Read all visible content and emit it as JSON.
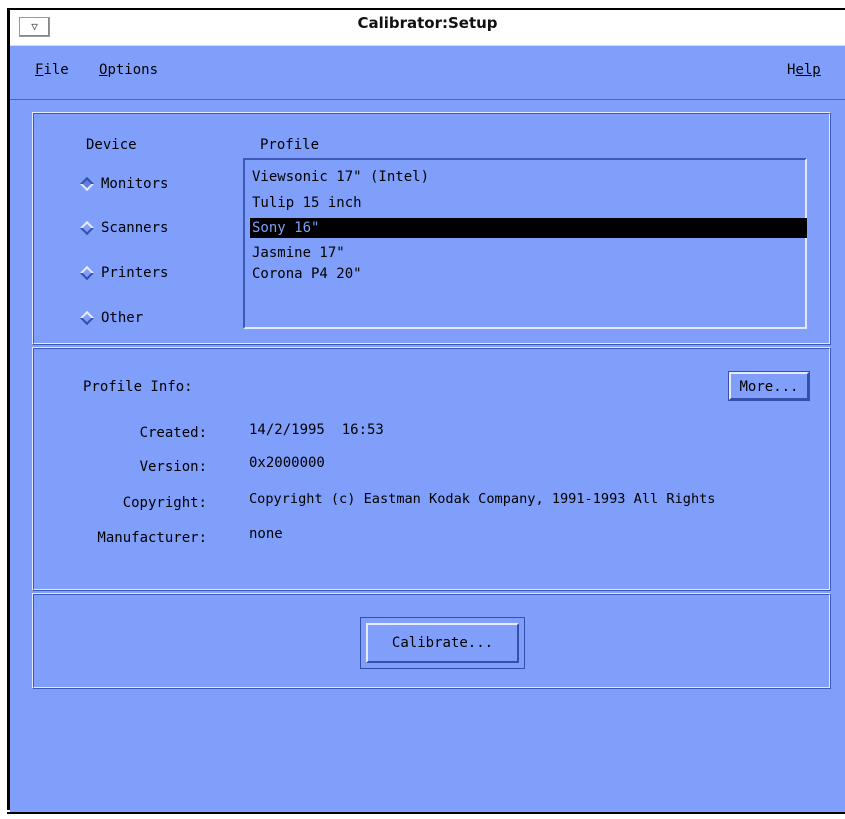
{
  "window": {
    "title": "Calibrator:Setup",
    "menu_button_glyph": "▽"
  },
  "menubar": {
    "file": {
      "mnemonic": "F",
      "rest": "ile"
    },
    "options": {
      "mnemonic": "O",
      "rest": "ptions"
    },
    "help": {
      "lead": "H",
      "rest": "elp"
    }
  },
  "device": {
    "heading": "Device",
    "options": [
      {
        "label": "Monitors",
        "selected": true
      },
      {
        "label": "Scanners",
        "selected": false
      },
      {
        "label": "Printers",
        "selected": false
      },
      {
        "label": "Other",
        "selected": false
      }
    ]
  },
  "profile": {
    "heading": "Profile",
    "items": [
      {
        "label": "Viewsonic 17\" (Intel)",
        "selected": false
      },
      {
        "label": "Tulip 15 inch",
        "selected": false
      },
      {
        "label": "Sony 16\"",
        "selected": true
      },
      {
        "label": "Jasmine 17\"",
        "selected": false
      },
      {
        "label": "Corona P4 20\"",
        "selected": false
      }
    ]
  },
  "profile_info": {
    "heading": "Profile Info:",
    "more_button": "More...",
    "created_label": "Created:",
    "created_value": "14/2/1995  16:53",
    "version_label": "Version:",
    "version_value": "0x2000000",
    "copyright_label": "Copyright:",
    "copyright_value": "Copyright (c) Eastman Kodak Company, 1991-1993 All Rights",
    "manufacturer_label": "Manufacturer:",
    "manufacturer_value": "none"
  },
  "actions": {
    "calibrate_button": "Calibrate..."
  },
  "colors": {
    "background": "#7f9ffb",
    "selection": "#000000"
  }
}
